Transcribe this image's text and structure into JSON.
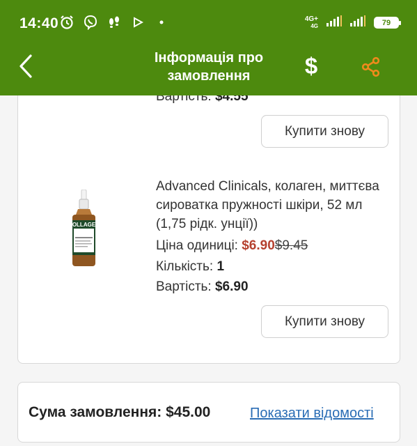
{
  "status_bar": {
    "time": "14:40",
    "network_label": "4G+",
    "network_sub": "4G",
    "battery": "79"
  },
  "header": {
    "title": "Інформація про замовлення",
    "currency_symbol": "$"
  },
  "previous_item": {
    "subtotal_label": "Вартість:",
    "subtotal_value": "$4.55",
    "buy_again_label": "Купити знову"
  },
  "item": {
    "name": "Advanced Clinicals, колаген, миттєва сироватка пружності шкіри, 52 мл (1,75 рідк. унції))",
    "image_label": "COLLAGEN",
    "unit_price_label": "Ціна одиниці:",
    "unit_price_sale": "$6.90",
    "unit_price_old": "$9.45",
    "quantity_label": "Кількість:",
    "quantity_value": "1",
    "subtotal_label": "Вартість:",
    "subtotal_value": "$6.90",
    "buy_again_label": "Купити знову"
  },
  "order_total": {
    "label": "Сума замовлення:",
    "value": "$45.00",
    "details_link": "Показати відомості"
  }
}
